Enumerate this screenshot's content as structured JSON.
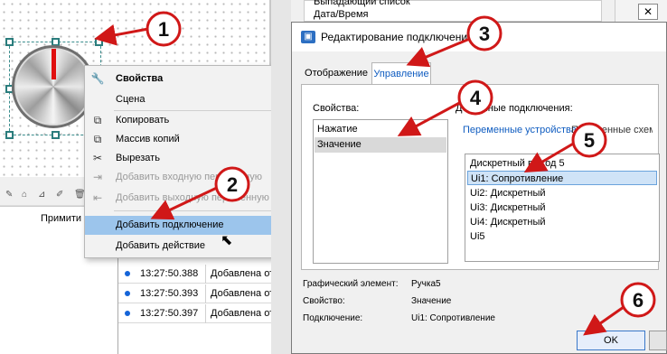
{
  "top_list": {
    "line1": "Выпадающий список",
    "line2": "Дата/Время"
  },
  "left_panel": {
    "column_header": "Примити"
  },
  "context_menu": {
    "items": [
      {
        "label": "Свойства",
        "icon": "wrench-icon",
        "glyph": "🔧"
      },
      {
        "label": "Сцена",
        "icon": "",
        "glyph": ""
      },
      {
        "label": "Копировать",
        "icon": "copy-icon",
        "glyph": "⧉"
      },
      {
        "label": "Массив копий",
        "icon": "copy-array-icon",
        "glyph": "⧉"
      },
      {
        "label": "Вырезать",
        "icon": "scissors-icon",
        "glyph": "✂"
      },
      {
        "label": "Добавить входную переменную",
        "icon": "add-input-icon",
        "glyph": "⇥"
      },
      {
        "label": "Добавить выходную переменную",
        "icon": "add-output-icon",
        "glyph": "⇤"
      },
      {
        "label": "Добавить подключение",
        "icon": "",
        "glyph": ""
      },
      {
        "label": "Добавить действие",
        "icon": "",
        "glyph": ""
      }
    ]
  },
  "log": {
    "rows": [
      {
        "time": "13:27:50.388",
        "message": "Добавлена отла"
      },
      {
        "time": "13:27:50.393",
        "message": "Добавлена отла"
      },
      {
        "time": "13:27:50.397",
        "message": "Добавлена отла"
      }
    ]
  },
  "dialog": {
    "title": "Редактирование подключения",
    "tabs": {
      "display": "Отображение",
      "control": "Управление"
    },
    "properties_label": "Свойства:",
    "properties": [
      "Нажатие",
      "Значение"
    ],
    "available_label": "Доступные подключения:",
    "subtabs": {
      "devices": "Переменные устройства",
      "schemes": "Переменные схемы"
    },
    "connections": [
      "Дискретный выход 5",
      "Ui1: Сопротивление",
      "Ui2: Дискретный",
      "Ui3: Дискретный",
      "Ui4: Дискретный",
      "Ui5"
    ],
    "info": {
      "element_label": "Графический элемент:",
      "element_value": "Ручка5",
      "property_label": "Свойство:",
      "property_value": "Значение",
      "connection_label": "Подключение:",
      "connection_value": "Ui1: Сопротивление"
    },
    "ok": "OK"
  },
  "callouts": [
    "1",
    "2",
    "3",
    "4",
    "5",
    "6"
  ],
  "colors": {
    "callout_red": "#d01818",
    "accent_blue": "#0f5cc0",
    "menu_highlight": "#9cc5ec"
  }
}
